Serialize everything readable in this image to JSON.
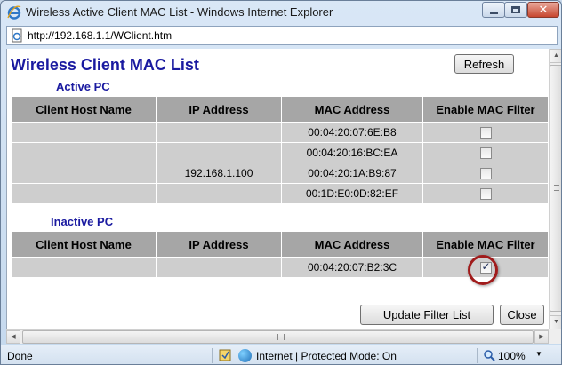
{
  "window": {
    "title": "Wireless Active Client MAC List - Windows Internet Explorer",
    "close_glyph": "✕"
  },
  "address": {
    "url": "http://192.168.1.1/WClient.htm"
  },
  "page": {
    "heading": "Wireless Client MAC List",
    "refresh_label": "Refresh",
    "active_label": "Active PC",
    "inactive_label": "Inactive PC",
    "columns": [
      "Client Host Name",
      "IP Address",
      "MAC Address",
      "Enable MAC Filter"
    ],
    "active_rows": [
      {
        "host": "",
        "ip": "",
        "mac": "00:04:20:07:6E:B8",
        "filter": false
      },
      {
        "host": "",
        "ip": "",
        "mac": "00:04:20:16:BC:EA",
        "filter": false
      },
      {
        "host": "",
        "ip": "192.168.1.100",
        "mac": "00:04:20:1A:B9:87",
        "filter": false
      },
      {
        "host": "",
        "ip": "",
        "mac": "00:1D:E0:0D:82:EF",
        "filter": false
      }
    ],
    "inactive_rows": [
      {
        "host": "",
        "ip": "",
        "mac": "00:04:20:07:B2:3C",
        "filter": true
      }
    ],
    "update_label": "Update Filter List",
    "close_label": "Close"
  },
  "scrollbars": {
    "up": "▲",
    "down": "▼",
    "left": "◀",
    "right": "▶"
  },
  "status": {
    "text": "Done",
    "zone": "Internet | Protected Mode: On",
    "zoom": "100%",
    "zoom_caret": "▼"
  },
  "colors": {
    "heading": "#1a1aa0",
    "header_cell": "#a6a6a6",
    "data_cell": "#cecece",
    "highlight_ring": "#a01b1b"
  },
  "icons": [
    "ie-logo-icon",
    "page-icon",
    "shield-icon",
    "globe-icon",
    "zoom-icon"
  ]
}
